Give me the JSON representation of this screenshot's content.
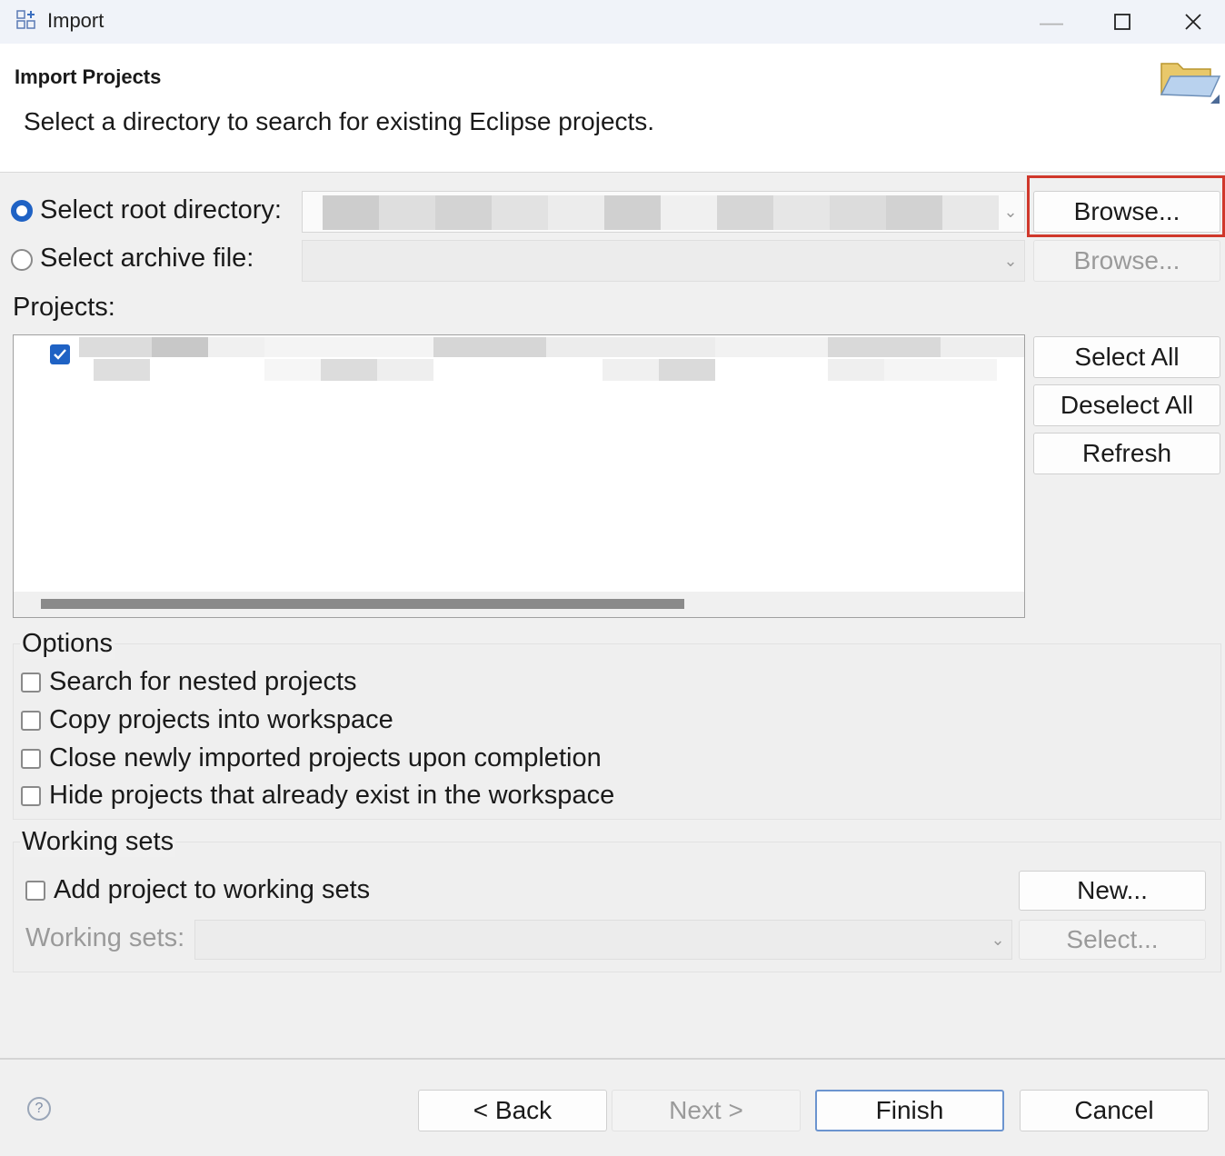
{
  "window": {
    "title": "Import",
    "minimize_icon": "minimize-icon",
    "maximize_icon": "maximize-icon",
    "close_icon": "close-icon"
  },
  "header": {
    "title": "Import Projects",
    "description": "Select a directory to search for existing Eclipse projects."
  },
  "source": {
    "root_label": "Select root directory:",
    "archive_label": "Select archive file:",
    "browse_label": "Browse...",
    "browse_archive_label": "Browse..."
  },
  "projects": {
    "label": "Projects:",
    "select_all": "Select All",
    "deselect_all": "Deselect All",
    "refresh": "Refresh"
  },
  "options": {
    "title": "Options",
    "items": [
      "Search for nested projects",
      "Copy projects into workspace",
      "Close newly imported projects upon completion",
      "Hide projects that already exist in the workspace"
    ]
  },
  "working_sets": {
    "title": "Working sets",
    "add_label": "Add project to working sets",
    "new_label": "New...",
    "sets_label": "Working sets:",
    "select_label": "Select..."
  },
  "footer": {
    "back": "< Back",
    "next": "Next >",
    "finish": "Finish",
    "cancel": "Cancel"
  },
  "colors": {
    "accent": "#1f62c4",
    "highlight": "#d0382b"
  }
}
